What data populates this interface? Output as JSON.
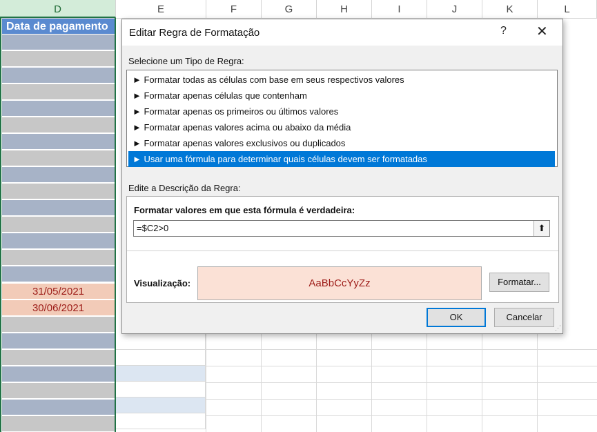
{
  "spreadsheet": {
    "columns": [
      "D",
      "E",
      "F",
      "G",
      "H",
      "I",
      "J",
      "K",
      "L"
    ],
    "header_cell": "Data de pagamento",
    "date_values": [
      "31/05/2021",
      "30/06/2021"
    ]
  },
  "dialog": {
    "title": "Editar Regra de Formatação",
    "help": "?",
    "close": "✕",
    "rule_type_label": "Selecione um Tipo de Regra:",
    "rule_types": [
      "► Formatar todas as células com base em seus respectivos valores",
      "► Formatar apenas células que contenham",
      "► Formatar apenas os primeiros ou últimos valores",
      "► Formatar apenas valores acima ou abaixo da média",
      "► Formatar apenas valores exclusivos ou duplicados",
      "► Usar uma fórmula para determinar quais células devem ser formatadas"
    ],
    "selected_index": 5,
    "description_label": "Edite a Descrição da Regra:",
    "formula_label": "Formatar valores em que esta fórmula é verdadeira:",
    "formula_value": "=$C2>0",
    "preview_label": "Visualização:",
    "preview_text": "AaBbCcYyZz",
    "format_button": "Formatar...",
    "ok_button": "OK",
    "cancel_button": "Cancelar",
    "colors": {
      "selection": "#0078d7",
      "preview_bg": "#fbe1d6",
      "preview_text": "#9c1a16"
    }
  }
}
